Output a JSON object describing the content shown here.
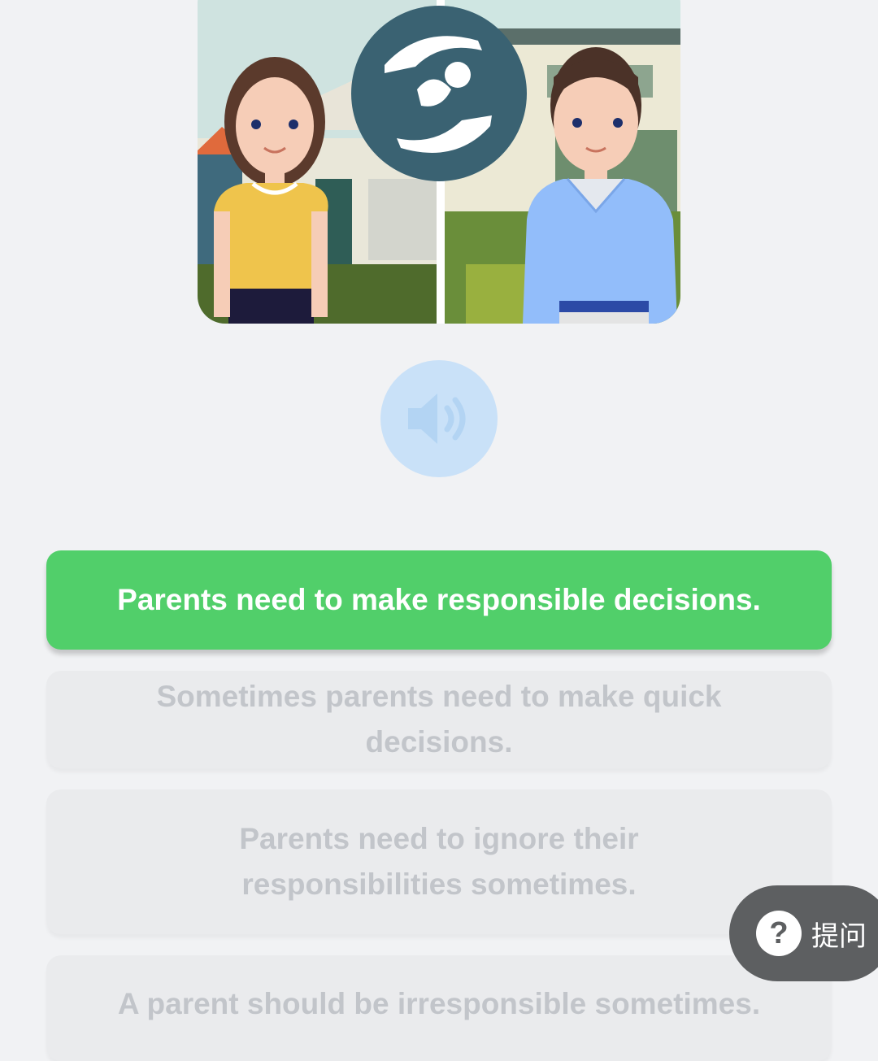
{
  "illustration": {
    "icon": "parental-care-icon",
    "description_icons": [
      "woman-figure",
      "man-figure",
      "house"
    ]
  },
  "audio": {
    "icon": "speaker-icon",
    "color": "#c9e1f8"
  },
  "options": [
    {
      "label": "Parents need to make responsible decisions.",
      "state": "correct"
    },
    {
      "label": "Sometimes parents need to make quick decisions.",
      "state": "disabled"
    },
    {
      "label": "Parents need to ignore their responsibilities sometimes.",
      "state": "disabled"
    },
    {
      "label": "A parent should be irresponsible sometimes.",
      "state": "disabled"
    }
  ],
  "ask_button": {
    "icon": "question-mark-icon",
    "icon_glyph": "?",
    "label": "提问"
  },
  "colors": {
    "correct": "#51cf6a",
    "disabled_bg": "#eaebed",
    "disabled_text": "#c2c5ca",
    "page_bg": "#f1f2f4",
    "ask_bg": "#5d5f61"
  }
}
